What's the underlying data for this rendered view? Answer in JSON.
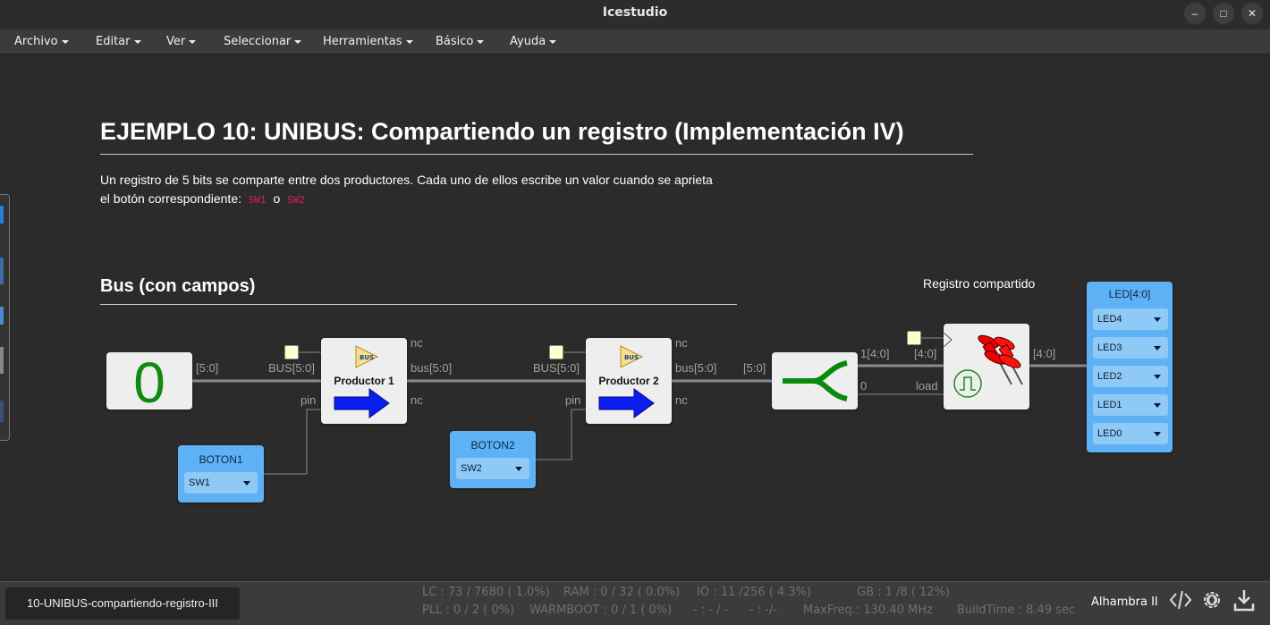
{
  "window": {
    "title": "Icestudio"
  },
  "menu": [
    {
      "label": "Archivo"
    },
    {
      "label": "Editar"
    },
    {
      "label": "Ver"
    },
    {
      "label": "Seleccionar"
    },
    {
      "label": "Herramientas"
    },
    {
      "label": "Básico"
    },
    {
      "label": "Ayuda"
    }
  ],
  "doc": {
    "title": "EJEMPLO 10: UNIBUS: Compartiendo un registro (Implementación IV)",
    "desc_line1": "Un registro de 5 bits se comparte entre dos productores. Cada uno de ellos escribe un valor cuando se aprieta",
    "desc_line2_prefix": "el botón correspondiente:",
    "code1": "SW1",
    "desc_or": "o",
    "code2": "SW2",
    "subtitle": "Bus (con campos)",
    "register_label": "Registro compartido"
  },
  "blocks": {
    "constant": {
      "value": "0",
      "out_label": "[5:0]"
    },
    "producer1": {
      "name": "Productor 1",
      "icon_text": "BUS",
      "in_bus": "BUS[5:0]",
      "in_pin": "pin",
      "out_nc_top": "nc",
      "out_bus": "bus[5:0]",
      "out_nc_bottom": "nc"
    },
    "producer2": {
      "name": "Productor 2",
      "icon_text": "BUS",
      "in_bus": "BUS[5:0]",
      "in_pin": "pin",
      "out_nc_top": "nc",
      "out_bus": "bus[5:0]",
      "out_nc_bottom": "nc"
    },
    "splitter": {
      "in_label": "[5:0]",
      "out_top": "1[4:0]",
      "out_bottom": "0"
    },
    "register": {
      "in_data": "[4:0]",
      "in_load": "load",
      "out_label": "[4:0]"
    },
    "button1": {
      "title": "BOTON1",
      "pin": "SW1"
    },
    "button2": {
      "title": "BOTON2",
      "pin": "SW2"
    },
    "leds": {
      "title": "LED[4:0]",
      "pins": [
        "LED4",
        "LED3",
        "LED2",
        "LED1",
        "LED0"
      ]
    }
  },
  "status": {
    "file": "10-UNIBUS-compartiendo-registro-III",
    "lc": "LC : 73 / 7680 ( 1.0%)",
    "ram": "RAM : 0 / 32 ( 0.0%)",
    "io": "IO : 11 /256  ( 4.3%)",
    "gb": "GB :  1 /8  ( 12%)",
    "pll": "PLL : 0 / 2 ( 0%)",
    "warmboot": "WARMBOOT : 0 / 1 ( 0%)",
    "pin1": "- : - / -",
    "pin2": "- : -/-",
    "maxfreq": "MaxFreq.:   130.40 MHz",
    "buildtime": "BuildTime :   8.49 sec",
    "board": "Alhambra II"
  },
  "icons": [
    "minimize-icon",
    "maximize-icon",
    "close-icon",
    "code-icon",
    "gear-icon",
    "download-icon",
    "bus-icon",
    "arrow-icon",
    "split-icon",
    "pulse-icon",
    "pushpin-icon"
  ]
}
